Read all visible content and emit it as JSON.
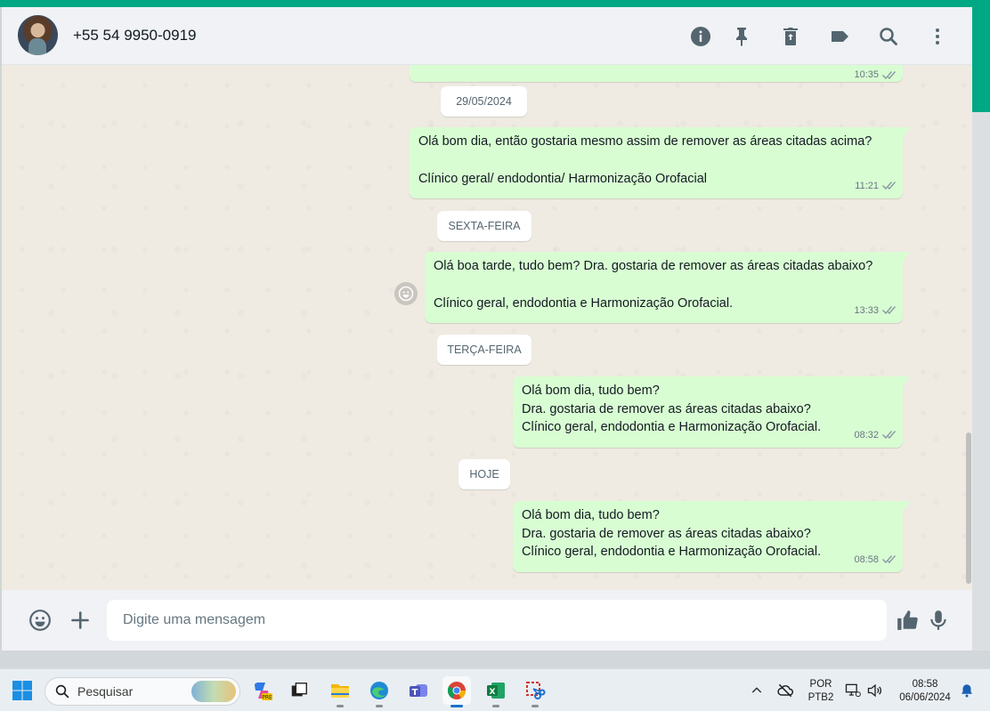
{
  "contact": {
    "name": "+55 54 9950-0919"
  },
  "header": {
    "icons": [
      "info-icon",
      "pin-icon",
      "delete-icon",
      "label-icon",
      "search-icon",
      "menu-icon"
    ]
  },
  "chat": {
    "partial_time": "10:35",
    "messages": [
      {
        "date": "29/05/2024",
        "lines": [
          "Olá bom dia, então gostaria mesmo assim de remover as áreas citadas acima?",
          "",
          "Clínico geral/ endodontia/ Harmonização Orofacial"
        ],
        "time": "11:21",
        "status": "read"
      },
      {
        "date": "SEXTA-FEIRA",
        "lines": [
          "Olá boa tarde, tudo bem? Dra. gostaria de remover as áreas citadas abaixo?",
          "",
          "Clínico geral, endodontia e  Harmonização Orofacial."
        ],
        "time": "13:33",
        "status": "read"
      },
      {
        "date": "TERÇA-FEIRA",
        "lines": [
          "Olá bom dia, tudo bem?",
          "Dra. gostaria de remover as áreas citadas abaixo?",
          "Clínico geral, endodontia e  Harmonização Orofacial."
        ],
        "time": "08:32",
        "status": "read"
      },
      {
        "date": "HOJE",
        "lines": [
          "Olá bom dia, tudo bem?",
          "Dra. gostaria de remover as áreas citadas abaixo?",
          "Clínico geral, endodontia e  Harmonização Orofacial."
        ],
        "time": "08:58",
        "status": "read"
      }
    ]
  },
  "composer": {
    "placeholder": "Digite uma mensagem"
  },
  "taskbar": {
    "search_label": "Pesquisar",
    "lang_top": "POR",
    "lang_bottom": "PTB2",
    "clock_time": "08:58",
    "clock_date": "06/06/2024"
  },
  "colors": {
    "accent": "#00a884",
    "bubble_out": "#d9fdd3",
    "chat_bg": "#efeae2"
  }
}
